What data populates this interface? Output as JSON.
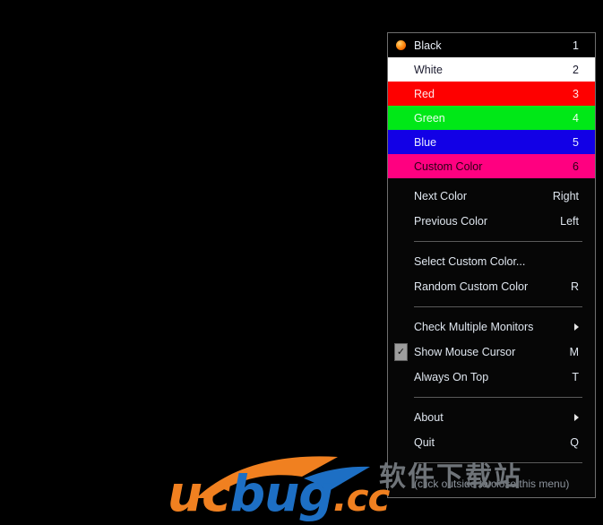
{
  "desktop": {
    "background_color": "#000000"
  },
  "context_menu": {
    "border_color": "#6e6e6e",
    "background_color": "#060606",
    "text_color": "#dfe6ef",
    "separator_color": "#5a5a5a",
    "color_items": [
      {
        "label": "Black",
        "accel": "1",
        "swatch": "#000000",
        "marker": "radio-bullet",
        "selected": true
      },
      {
        "label": "White",
        "accel": "2",
        "swatch": "#ffffff",
        "marker": "",
        "selected": false
      },
      {
        "label": "Red",
        "accel": "3",
        "swatch": "#fe0000",
        "marker": "",
        "selected": false
      },
      {
        "label": "Green",
        "accel": "4",
        "swatch": "#00e817",
        "marker": "",
        "selected": false
      },
      {
        "label": "Blue",
        "accel": "5",
        "swatch": "#1200e6",
        "marker": "",
        "selected": false
      },
      {
        "label": "Custom Color",
        "accel": "6",
        "swatch": "#ff0080",
        "marker": "",
        "selected": false
      }
    ],
    "navigation_items": [
      {
        "label": "Next Color",
        "accel": "Right"
      },
      {
        "label": "Previous Color",
        "accel": "Left"
      }
    ],
    "custom_items": [
      {
        "label": "Select Custom Color...",
        "accel": ""
      },
      {
        "label": "Random Custom Color",
        "accel": "R"
      }
    ],
    "option_items": [
      {
        "label": "Check Multiple Monitors",
        "accel": "",
        "submenu": true,
        "checked": false
      },
      {
        "label": "Show Mouse Cursor",
        "accel": "M",
        "submenu": false,
        "checked": true
      },
      {
        "label": "Always On Top",
        "accel": "T",
        "submenu": false,
        "checked": false
      }
    ],
    "app_items": [
      {
        "label": "About",
        "accel": "",
        "submenu": true
      },
      {
        "label": "Quit",
        "accel": "Q",
        "submenu": false
      }
    ],
    "footer_hint": "(click outside to close this menu)"
  },
  "watermark": {
    "chinese_text": "软件下载站",
    "brand_uc": "uc",
    "brand_bug": "bug",
    "brand_tld": ".cc",
    "orange": "#f08020",
    "blue": "#1d6fc4"
  }
}
